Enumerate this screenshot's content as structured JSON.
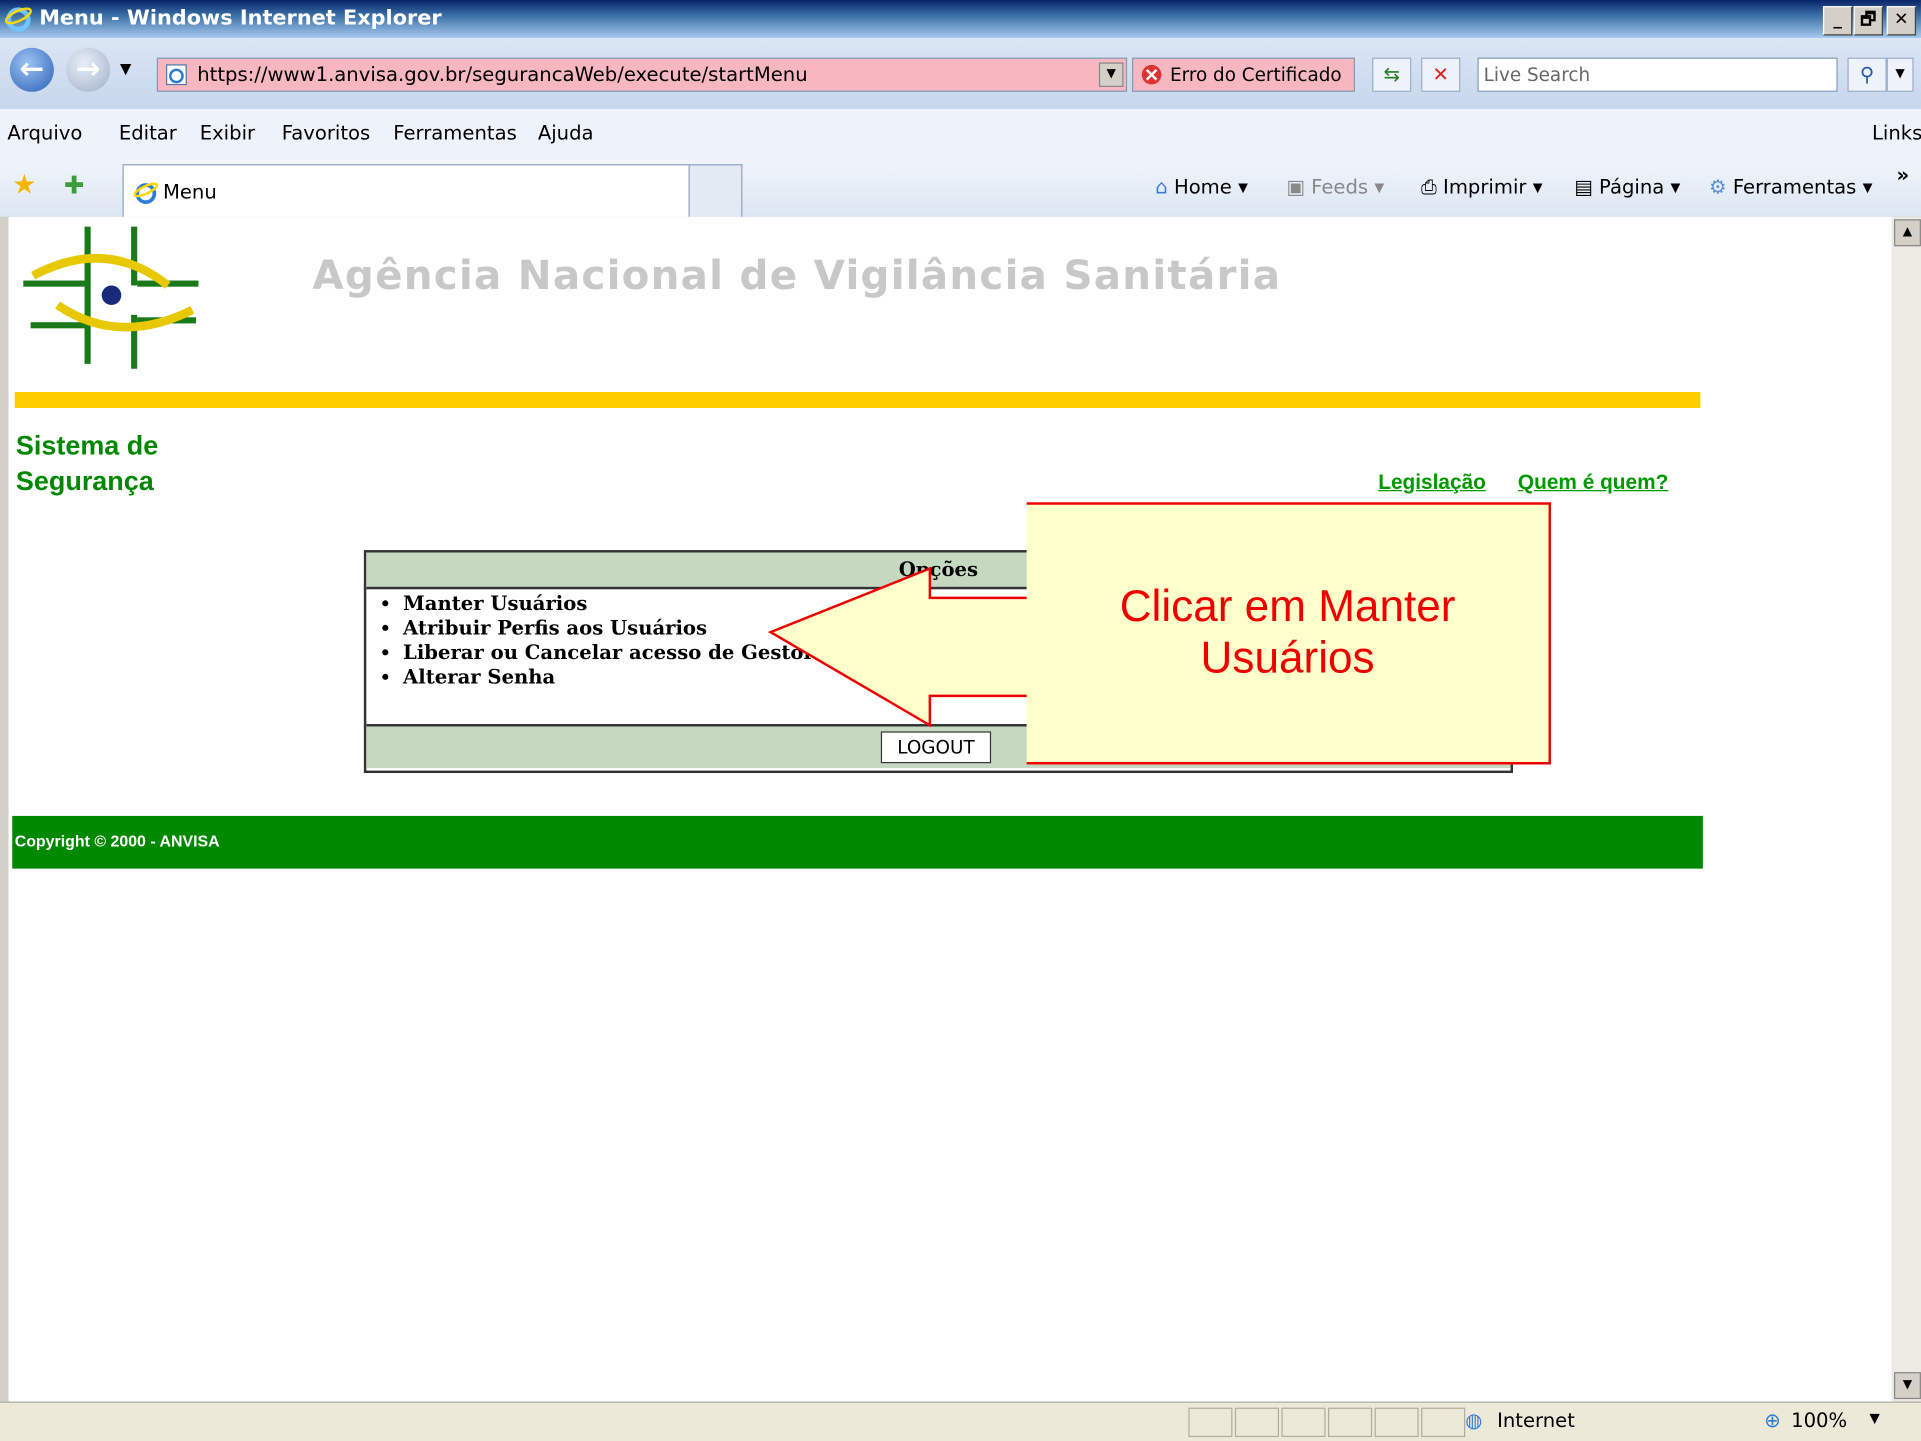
{
  "window": {
    "title": "Menu - Windows Internet Explorer",
    "min": "_",
    "max": "🗗",
    "close": "✕"
  },
  "address": {
    "url": "https://www1.anvisa.gov.br/segurancaWeb/execute/startMenu",
    "cert": "Erro do Certificado",
    "search_placeholder": "Live Search",
    "back": "←",
    "forward": "→"
  },
  "menu": {
    "items": [
      "Arquivo",
      "Editar",
      "Exibir",
      "Favoritos",
      "Ferramentas",
      "Ajuda"
    ],
    "links": "Links"
  },
  "favbar": {
    "tab": "Menu",
    "home": "Home",
    "feeds": "Feeds",
    "print": "Imprimir",
    "page": "Página",
    "tools": "Ferramentas",
    "more": "»"
  },
  "page": {
    "agency": "Agência Nacional de Vigilância Sanitária",
    "system_line1": "Sistema de",
    "system_line2": "Segurança",
    "link_legislacao": "Legislação",
    "link_quem": "Quem é quem?",
    "options_header": "Opções",
    "options": [
      "Manter Usuários",
      "Atribuir Perfis aos Usuários",
      "Liberar ou Cancelar acesso de Gestor de Segurança",
      "Alterar Senha"
    ],
    "logout": "LOGOUT",
    "copyright": "Copyright © 2000 - ANVISA"
  },
  "callout": {
    "line1": "Clicar em Manter",
    "line2": "Usuários"
  },
  "status": {
    "zone": "Internet",
    "zoom": "100%"
  },
  "colors": {
    "green": "#008800",
    "yellow": "#ffcc00",
    "callout_red": "#e00000",
    "callout_fill": "#ffffcc",
    "table_header": "#c5d9c1"
  }
}
